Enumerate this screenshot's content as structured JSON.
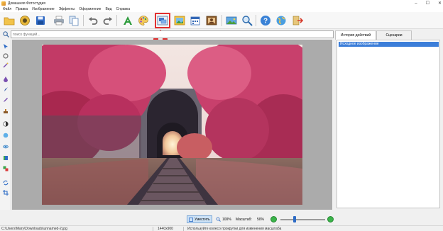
{
  "window": {
    "title": "Домашняя Фотостудия"
  },
  "menu": [
    "Файл",
    "Правка",
    "Изображение",
    "Эффекты",
    "Оформление",
    "Вид",
    "Справка"
  ],
  "toolbar": {
    "icons": [
      "open-folder-icon",
      "camera-icon",
      "save-icon",
      "print-icon",
      "copy-icon",
      "undo-icon",
      "redo-icon",
      "text-icon",
      "palette-icon",
      "image-frame-icon",
      "landscape-icon",
      "calendar-icon",
      "portrait-icon",
      "panorama-icon",
      "zoom-icon",
      "help-icon",
      "globe-icon",
      "exit-icon"
    ],
    "highlighted": "image-frame-icon",
    "arrow_color": "#e23030"
  },
  "search": {
    "placeholder": "поиск функций..."
  },
  "right_panel": {
    "tabs": [
      "История действий",
      "Сценарии"
    ],
    "active_tab": "История действий",
    "history": [
      "Исходное изображение"
    ]
  },
  "bottom": {
    "fit_label": "Уместить",
    "zoom_100_label": "100%",
    "zoom_label": "Масштаб:",
    "zoom_value": "50%",
    "zoom_slider_fraction": 0.3
  },
  "status": {
    "path": "C:\\Users\\Mary\\Downloads\\unnamed-2.jpg",
    "dimensions": "1440x900",
    "hint": "Используйте колесо прокрутки для изменения масштаба"
  },
  "colors": {
    "accent": "#3c7ed9",
    "highlight": "#e23030",
    "canvas_bg": "#ababab"
  }
}
